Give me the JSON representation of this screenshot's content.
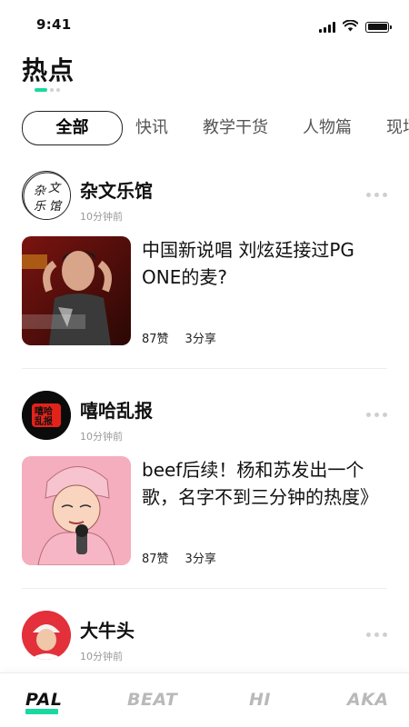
{
  "status_bar": {
    "time": "9:41"
  },
  "header": {
    "title": "热点"
  },
  "tabs": [
    {
      "label": "全部",
      "active": true
    },
    {
      "label": "快讯"
    },
    {
      "label": "教学干货"
    },
    {
      "label": "人物篇"
    },
    {
      "label": "现场"
    }
  ],
  "posts": [
    {
      "author": "杂文乐馆",
      "avatar_text": "杂文乐馆",
      "time": "10分钟前",
      "title": "中国新说唱 刘炫廷接过PG ONE的麦?",
      "likes": "87赞",
      "shares": "3分享"
    },
    {
      "author": "嘻哈乱报",
      "avatar_text": "嘻哈乱报",
      "time": "10分钟前",
      "title": "beef后续！杨和苏发出一个歌，名字不到三分钟的热度》",
      "likes": "87赞",
      "shares": "3分享"
    },
    {
      "author": "大牛头",
      "time": "10分钟前"
    }
  ],
  "bottom_nav": [
    {
      "label": "PAL",
      "active": true
    },
    {
      "label": "BEAT"
    },
    {
      "label": "HI"
    },
    {
      "label": "AKA"
    }
  ],
  "colors": {
    "accent": "#19d9a0"
  },
  "icons": [
    "signal-icon",
    "wifi-icon",
    "battery-icon",
    "more-icon"
  ]
}
